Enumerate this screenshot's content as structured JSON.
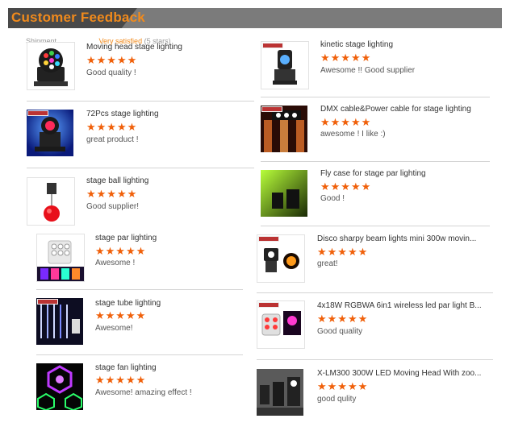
{
  "section": {
    "title": "Customer Feedback"
  },
  "ghost": {
    "left": "Shipment",
    "right": "Very satisfied",
    "count": "(5 stars)"
  },
  "star_rating": "★★★★★",
  "rating_value": 5,
  "reviews_left": [
    {
      "product": "Moving head stage lighting",
      "comment": "Good quality !"
    },
    {
      "product": "72Pcs stage lighting",
      "comment": "great product !"
    },
    {
      "product": "stage ball lighting",
      "comment": "Good supplier!"
    },
    {
      "product": "stage par lighting",
      "comment": "Awesome !"
    },
    {
      "product": "stage tube lighting",
      "comment": "Awesome!"
    },
    {
      "product": "stage fan lighting",
      "comment": "Awesome! amazing effect !"
    }
  ],
  "reviews_right": [
    {
      "product": "kinetic stage lighting",
      "comment": "Awesome !! Good supplier"
    },
    {
      "product": "DMX cable&Power cable for stage lighting",
      "comment": "awesome ! I like :)"
    },
    {
      "product": "Fly case for stage par lighting",
      "comment": "Good !"
    },
    {
      "product": "Disco sharpy beam lights mini 300w movin...",
      "comment": "great!"
    },
    {
      "product": "4x18W RGBWA 6in1 wireless led par light B...",
      "comment": "Good quality"
    },
    {
      "product": "X-LM300 300W LED Moving Head With zoo...",
      "comment": "good qulity"
    }
  ]
}
